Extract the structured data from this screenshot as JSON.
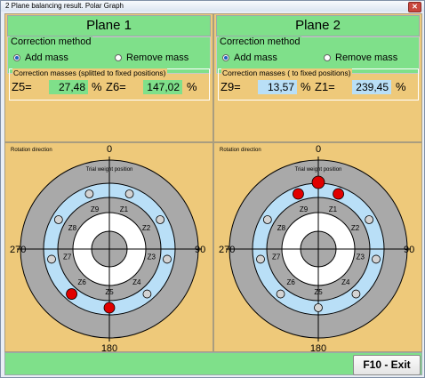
{
  "window": {
    "title": "2 Plane balancing result. Polar Graph",
    "close_glyph": "✕"
  },
  "colors": {
    "panel": "#eec97a",
    "accent_green": "#7fe08a",
    "value_blue": "#b9dff7",
    "mass_red": "#e00000"
  },
  "planes": [
    {
      "title": "Plane 1",
      "correction_method_label": "Correction method",
      "add_mass_label": "Add mass",
      "remove_mass_label": "Remove mass",
      "selected_method": "Add mass",
      "masses_label": "Correction masses (splitted to fixed positions)",
      "mass_a": {
        "label": "Z5=",
        "value": "27,48",
        "unit": "%"
      },
      "mass_b": {
        "label": "Z6=",
        "value": "147,02",
        "unit": "%"
      },
      "rotation_label": "Rotation direction",
      "trial_label": "Trial weight position",
      "angles": {
        "top": "0",
        "right": "90",
        "bottom": "180",
        "left": "270"
      },
      "positions": [
        "Z1",
        "Z2",
        "Z3",
        "Z4",
        "Z5",
        "Z6",
        "Z7",
        "Z8",
        "Z9"
      ],
      "marked_positions": [
        "Z5",
        "Z6"
      ],
      "trial_mass_shown": false
    },
    {
      "title": "Plane 2",
      "correction_method_label": "Correction method",
      "add_mass_label": "Add mass",
      "remove_mass_label": "Remove mass",
      "selected_method": "Add mass",
      "masses_label": "Correction masses ( to fixed positions)",
      "mass_a": {
        "label": "Z9=",
        "value": "13,57",
        "unit": "%"
      },
      "mass_b": {
        "label": "Z1=",
        "value": "239,45",
        "unit": "%"
      },
      "rotation_label": "Rotation direction",
      "trial_label": "Trial weight position",
      "angles": {
        "top": "0",
        "right": "90",
        "bottom": "180",
        "left": "270"
      },
      "positions": [
        "Z1",
        "Z2",
        "Z3",
        "Z4",
        "Z5",
        "Z6",
        "Z7",
        "Z8",
        "Z9"
      ],
      "marked_positions": [
        "Z9",
        "Z1"
      ],
      "trial_mass_shown": true
    }
  ],
  "exit_button": "F10 - Exit"
}
